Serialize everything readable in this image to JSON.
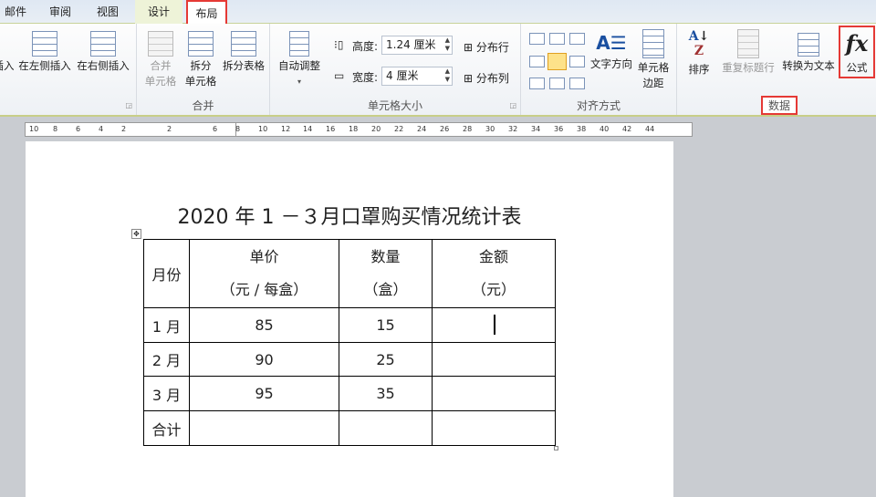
{
  "tabs": [
    "邮件",
    "审阅",
    "视图",
    "设计",
    "布局"
  ],
  "ribbon": {
    "rows_cols": {
      "insert_below": "插入",
      "insert_left": "在左侧插入",
      "insert_right": "在右侧插入"
    },
    "merge": {
      "merge_cells": "合并\n单元格",
      "split_cells": "拆分\n单元格",
      "split_table": "拆分表格",
      "label": "合并"
    },
    "cell_size": {
      "autofit": "自动调整",
      "height_label": "高度:",
      "height_value": "1.24 厘米",
      "width_label": "宽度:",
      "width_value": "4 厘米",
      "distribute_rows": "分布行",
      "distribute_cols": "分布列",
      "label": "单元格大小"
    },
    "alignment": {
      "text_direction": "文字方向",
      "cell_margins": "单元格\n边距",
      "label": "对齐方式"
    },
    "data": {
      "sort": "排序",
      "repeat_header": "重复标题行",
      "convert_to_text": "转换为文本",
      "formula": "公式",
      "label": "数据"
    }
  },
  "ruler": [
    "10",
    "8",
    "6",
    "4",
    "2",
    "2",
    "6",
    "8",
    "10",
    "12",
    "14",
    "16",
    "18",
    "20",
    "22",
    "24",
    "26",
    "28",
    "30",
    "32",
    "34",
    "36",
    "38",
    "40",
    "42",
    "44"
  ],
  "document": {
    "title": "2020 年 1 －３月口罩购买情况统计表",
    "header": {
      "month": "月份",
      "price": "单价",
      "price_unit": "（元 / 每盒）",
      "qty": "数量",
      "qty_unit": "（盒）",
      "amount": "金额",
      "amount_unit": "（元）"
    },
    "rows": [
      {
        "month": "1 月",
        "price": "85",
        "qty": "15",
        "amount": ""
      },
      {
        "month": "2 月",
        "price": "90",
        "qty": "25",
        "amount": ""
      },
      {
        "month": "3 月",
        "price": "95",
        "qty": "35",
        "amount": ""
      },
      {
        "month": "合计",
        "price": "",
        "qty": "",
        "amount": ""
      }
    ]
  }
}
